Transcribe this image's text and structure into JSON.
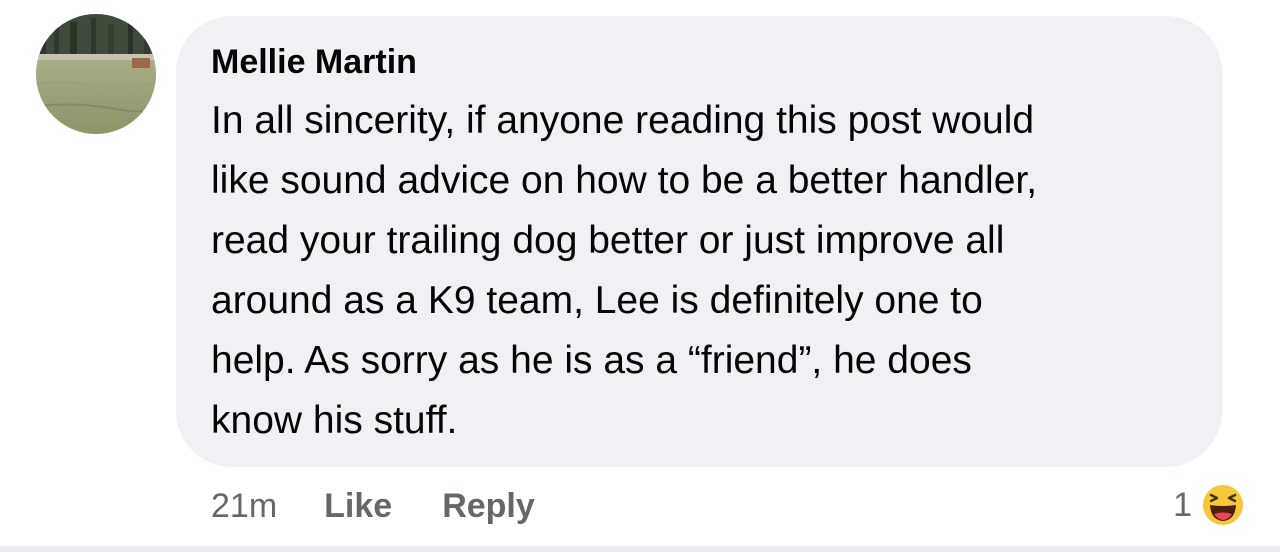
{
  "comment": {
    "author": "Mellie Martin",
    "lines": [
      "In all sincerity, if anyone reading this post would",
      "like sound advice on how to be a better handler,",
      "read your trailing dog better or just improve all",
      "around as a K9 team, Lee is definitely one to",
      "help. As sorry as he is as a “friend”, he does",
      "know his stuff."
    ],
    "timestamp": "21m",
    "like_label": "Like",
    "reply_label": "Reply",
    "reaction_count": "1",
    "reaction_icon": "laughing-emoji-icon"
  },
  "colors": {
    "bubble": "#eff1f4",
    "text": "#050505",
    "meta": "#65676b"
  }
}
